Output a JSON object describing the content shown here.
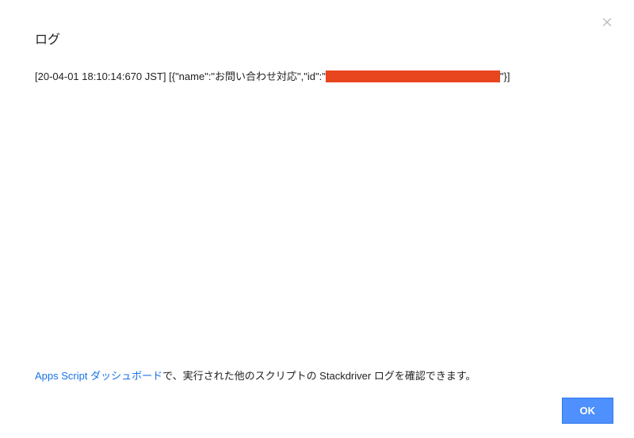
{
  "dialog": {
    "title": "ログ",
    "close_icon": "close"
  },
  "log": {
    "prefix": "[20-04-01 18:10:14:670 JST] [{\"name\":\"お問い合わせ対応\",\"id\":\"",
    "suffix": "\"}]"
  },
  "footer": {
    "link_text": "Apps Script ダッシュボード",
    "rest_text": "で、実行された他のスクリプトの Stackdriver ログを確認できます。"
  },
  "buttons": {
    "ok": "OK"
  }
}
